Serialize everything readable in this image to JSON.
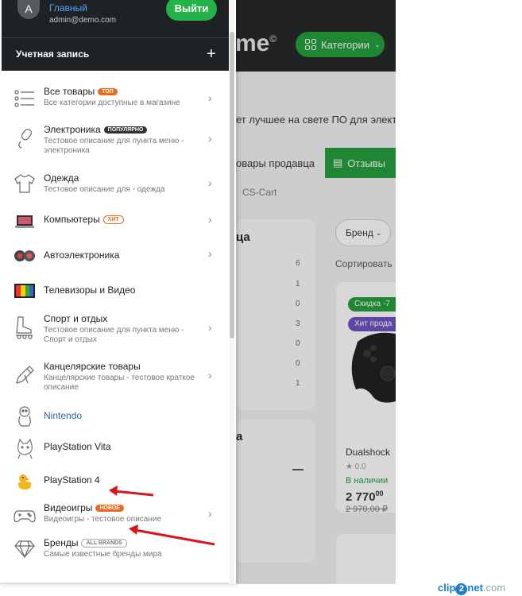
{
  "background": {
    "logo": "me",
    "categories_button": "Категории",
    "tagline": "ет лучшее на свете ПО для электро",
    "tab_goods": "овары продавца",
    "tab_reviews": "Отзывы",
    "breadcrumb": "CS-Cart",
    "card1_title": "ца",
    "counts": [
      "6",
      "1",
      "0",
      "3",
      "0",
      "0",
      "1"
    ],
    "card2_title": "а",
    "brand_filter": "Бренд",
    "sort_label": "Сортировать",
    "badge_discount": "Скидка -7",
    "badge_hit": "Хит прода",
    "product_name": "Dualshock",
    "rating": "0.0",
    "in_stock": "В наличии",
    "price": "2 770",
    "price_cents": "00",
    "old_price": "2 970,00 ₽"
  },
  "user": {
    "avatar_letter": "A",
    "name": "Главный",
    "email": "admin@demo.com",
    "logout_label": "Выйти"
  },
  "account": {
    "label": "Учетная запись"
  },
  "menu": [
    {
      "title": "Все товары",
      "badge": "ТОП",
      "desc": "Все категории доступные в магазине",
      "icon": "list-icon"
    },
    {
      "title": "Электроника",
      "badge": "ПОПУЛЯРНО",
      "desc": "Тестовое описание для пункта меню - электроника",
      "icon": "microphone-icon"
    },
    {
      "title": "Одежда",
      "badge": "",
      "desc": "Тестовое описание для - одежда",
      "icon": "tshirt-icon"
    },
    {
      "title": "Компьютеры",
      "badge": "ХИТ",
      "desc": "",
      "icon": "laptop-icon"
    },
    {
      "title": "Автоэлектроника",
      "badge": "",
      "desc": "",
      "icon": "speakers-icon"
    },
    {
      "title": "Телевизоры и Видео",
      "badge": "",
      "desc": "",
      "icon": "tv-icon"
    },
    {
      "title": "Спорт и отдых",
      "badge": "",
      "desc": "Тестовое описание для пункта меню - Спорт и отдых",
      "icon": "skate-icon"
    },
    {
      "title": "Канцелярские товары",
      "badge": "",
      "desc": "Канцелярские товары - тестовое краткое описание",
      "icon": "pencil-icon"
    },
    {
      "title": "Nintendo",
      "badge": "",
      "desc": "",
      "icon": "nintendo-icon"
    },
    {
      "title": "PlayStation Vita",
      "badge": "",
      "desc": "",
      "icon": "cat-icon"
    },
    {
      "title": "PlayStation 4",
      "badge": "",
      "desc": "",
      "icon": "duck-icon"
    },
    {
      "title": "Видеоигры",
      "badge": "НОВОЕ",
      "desc": "Видеоигры - тестовое описание",
      "icon": "gamepad-icon"
    },
    {
      "title": "Бренды",
      "badge": "ALL BRANDS",
      "desc": "Самые известные бренды мира",
      "icon": "diamond-icon"
    }
  ],
  "watermark": {
    "part1": "clip",
    "part2": "2",
    "part3": "net",
    "part4": ".com"
  }
}
